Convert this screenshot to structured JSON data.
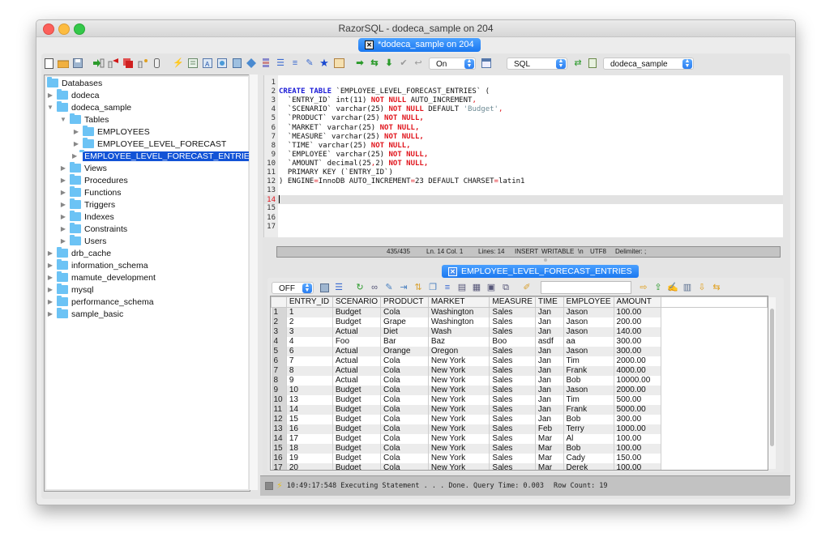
{
  "window": {
    "title": "RazorSQL - dodeca_sample on 204",
    "doc_tab": "*dodeca_sample on 204"
  },
  "toolbar": {
    "icons": [
      "new-file-icon",
      "open-folder-icon",
      "save-icon",
      "connect-icon",
      "disconnect-icon",
      "stop-icon",
      "add-connection-icon",
      "database-icon",
      "execute-icon",
      "script-icon",
      "explain-icon",
      "compare-icon",
      "query-builder-icon",
      "diamond-icon",
      "database-stack-icon",
      "format-sql-icon",
      "align-icon",
      "edit-icon",
      "favorite-star-icon",
      "export-icon",
      "next-icon",
      "swap-icon",
      "down-icon",
      "commit-icon",
      "rollback-icon"
    ],
    "autocommit_value": "On",
    "language_value": "SQL",
    "database_value": "dodeca_sample"
  },
  "tree": {
    "root": "Databases",
    "items": [
      {
        "label": "dodeca",
        "level": 1,
        "expanded": false
      },
      {
        "label": "dodeca_sample",
        "level": 1,
        "expanded": true
      },
      {
        "label": "Tables",
        "level": 2,
        "expanded": true
      },
      {
        "label": "EMPLOYEES",
        "level": 3,
        "expanded": false
      },
      {
        "label": "EMPLOYEE_LEVEL_FORECAST",
        "level": 3,
        "expanded": false
      },
      {
        "label": "EMPLOYEE_LEVEL_FORECAST_ENTRIES",
        "level": 3,
        "expanded": false,
        "selected": true
      },
      {
        "label": "Views",
        "level": 2,
        "expanded": false
      },
      {
        "label": "Procedures",
        "level": 2,
        "expanded": false
      },
      {
        "label": "Functions",
        "level": 2,
        "expanded": false
      },
      {
        "label": "Triggers",
        "level": 2,
        "expanded": false
      },
      {
        "label": "Indexes",
        "level": 2,
        "expanded": false
      },
      {
        "label": "Constraints",
        "level": 2,
        "expanded": false
      },
      {
        "label": "Users",
        "level": 2,
        "expanded": false
      },
      {
        "label": "drb_cache",
        "level": 1,
        "expanded": false
      },
      {
        "label": "information_schema",
        "level": 1,
        "expanded": false
      },
      {
        "label": "mamute_development",
        "level": 1,
        "expanded": false
      },
      {
        "label": "mysql",
        "level": 1,
        "expanded": false
      },
      {
        "label": "performance_schema",
        "level": 1,
        "expanded": false
      },
      {
        "label": "sample_basic",
        "level": 1,
        "expanded": false
      }
    ]
  },
  "editor": {
    "current_line": 14,
    "lines": [
      [],
      [
        [
          "kw",
          "CREATE TABLE"
        ],
        [
          "t",
          " `EMPLOYEE_LEVEL_FORECAST_ENTRIES` ("
        ]
      ],
      [
        [
          "t",
          "  `ENTRY_ID` int(11) "
        ],
        [
          "nn",
          "NOT NULL"
        ],
        [
          "t",
          " AUTO_INCREMENT"
        ],
        [
          "op",
          ","
        ]
      ],
      [
        [
          "t",
          "  `SCENARIO` varchar(25) "
        ],
        [
          "nn",
          "NOT NULL"
        ],
        [
          "t",
          " DEFAULT "
        ],
        [
          "str",
          "'Budget'"
        ],
        [
          "op",
          ","
        ]
      ],
      [
        [
          "t",
          "  `PRODUCT` varchar(25) "
        ],
        [
          "nn",
          "NOT NULL,"
        ]
      ],
      [
        [
          "t",
          "  `MARKET` varchar(25) "
        ],
        [
          "nn",
          "NOT NULL,"
        ]
      ],
      [
        [
          "t",
          "  `MEASURE` varchar(25) "
        ],
        [
          "nn",
          "NOT NULL,"
        ]
      ],
      [
        [
          "t",
          "  `TIME` varchar(25) "
        ],
        [
          "nn",
          "NOT NULL,"
        ]
      ],
      [
        [
          "t",
          "  `EMPLOYEE` varchar(25) "
        ],
        [
          "nn",
          "NOT NULL,"
        ]
      ],
      [
        [
          "t",
          "  `AMOUNT` decimal(25"
        ],
        [
          "op",
          ","
        ],
        [
          "t",
          "2) "
        ],
        [
          "nn",
          "NOT NULL,"
        ]
      ],
      [
        [
          "t",
          "  PRIMARY KEY (`ENTRY_ID`)"
        ]
      ],
      [
        [
          "t",
          ") ENGINE"
        ],
        [
          "op",
          "="
        ],
        [
          "t",
          "InnoDB AUTO_INCREMENT"
        ],
        [
          "op",
          "="
        ],
        [
          "t",
          "23 DEFAULT CHARSET"
        ],
        [
          "op",
          "="
        ],
        [
          "t",
          "latin1"
        ]
      ],
      [],
      [],
      [],
      [],
      []
    ]
  },
  "editor_status": {
    "position": "435/435",
    "cursor": "Ln. 14 Col. 1",
    "lines": "Lines: 14",
    "mode": "INSERT",
    "writable": "WRITABLE",
    "newline": "\\n",
    "encoding": "UTF8",
    "delimiter": "Delimiter: ;"
  },
  "results": {
    "tab_label": "EMPLOYEE_LEVEL_FORECAST_ENTRIES",
    "fetch_mode": "OFF",
    "filter_value": "",
    "columns": [
      "ENTRY_ID",
      "SCENARIO",
      "PRODUCT",
      "MARKET",
      "MEASURE",
      "TIME",
      "EMPLOYEE",
      "AMOUNT"
    ],
    "rows": [
      [
        "1",
        "Budget",
        "Cola",
        "Washington",
        "Sales",
        "Jan",
        "Jason",
        "100.00"
      ],
      [
        "2",
        "Budget",
        "Grape",
        "Washington",
        "Sales",
        "Jan",
        "Jason",
        "200.00"
      ],
      [
        "3",
        "Actual",
        "Diet",
        "Wash",
        "Sales",
        "Jan",
        "Jason",
        "140.00"
      ],
      [
        "4",
        "Foo",
        "Bar",
        "Baz",
        "Boo",
        "asdf",
        "aa",
        "300.00"
      ],
      [
        "6",
        "Actual",
        "Orange",
        "Oregon",
        "Sales",
        "Jan",
        "Jason",
        "300.00"
      ],
      [
        "7",
        "Actual",
        "Cola",
        "New York",
        "Sales",
        "Jan",
        "Tim",
        "2000.00"
      ],
      [
        "8",
        "Actual",
        "Cola",
        "New York",
        "Sales",
        "Jan",
        "Frank",
        "4000.00"
      ],
      [
        "9",
        "Actual",
        "Cola",
        "New York",
        "Sales",
        "Jan",
        "Bob",
        "10000.00"
      ],
      [
        "10",
        "Budget",
        "Cola",
        "New York",
        "Sales",
        "Jan",
        "Jason",
        "2000.00"
      ],
      [
        "13",
        "Budget",
        "Cola",
        "New York",
        "Sales",
        "Jan",
        "Tim",
        "500.00"
      ],
      [
        "14",
        "Budget",
        "Cola",
        "New York",
        "Sales",
        "Jan",
        "Frank",
        "5000.00"
      ],
      [
        "15",
        "Budget",
        "Cola",
        "New York",
        "Sales",
        "Jan",
        "Bob",
        "300.00"
      ],
      [
        "16",
        "Budget",
        "Cola",
        "New York",
        "Sales",
        "Feb",
        "Terry",
        "1000.00"
      ],
      [
        "17",
        "Budget",
        "Cola",
        "New York",
        "Sales",
        "Mar",
        "Al",
        "100.00"
      ],
      [
        "18",
        "Budget",
        "Cola",
        "New York",
        "Sales",
        "Mar",
        "Bob",
        "100.00"
      ],
      [
        "19",
        "Budget",
        "Cola",
        "New York",
        "Sales",
        "Mar",
        "Cady",
        "150.00"
      ],
      [
        "20",
        "Budget",
        "Cola",
        "New York",
        "Sales",
        "Mar",
        "Derek",
        "100.00"
      ]
    ]
  },
  "status_bar": {
    "message": "10:49:17:548 Executing Statement . . . Done. Query Time: 0.003",
    "row_count": "Row Count: 19"
  },
  "colors": {
    "accent": "#1b78f0",
    "selection": "#1253d6",
    "keyword": "#1a1ad6",
    "not_null": "#e0141c",
    "folder": "#6cc3f5"
  }
}
